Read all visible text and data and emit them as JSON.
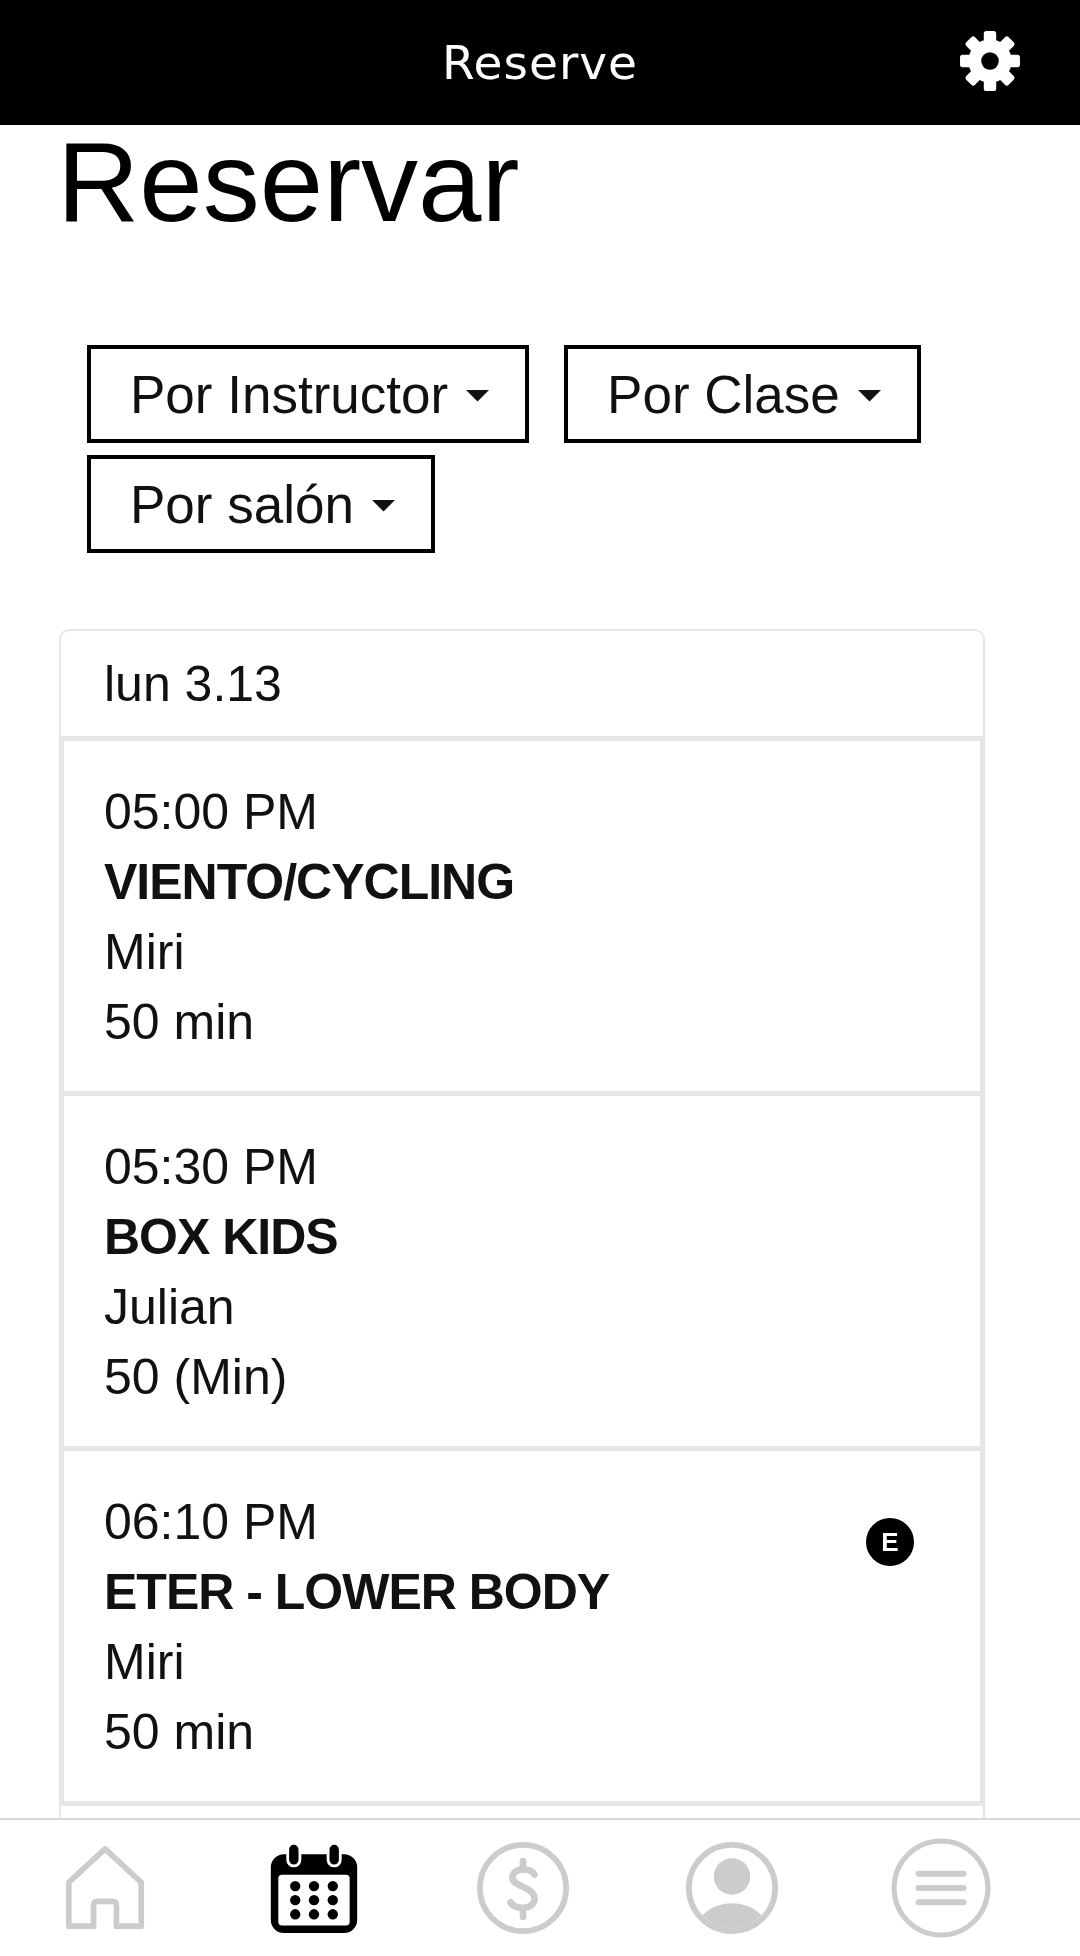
{
  "top_bar": {
    "title": "Reserve"
  },
  "page_title": "Reservar",
  "filters": [
    {
      "label": "Por Instructor"
    },
    {
      "label": "Por Clase"
    },
    {
      "label": "Por salón"
    }
  ],
  "schedule": {
    "date": "lun 3.13",
    "classes": [
      {
        "time": "05:00 PM",
        "name": "VIENTO/CYCLING",
        "instructor": "Miri",
        "duration": "50 min"
      },
      {
        "time": "05:30 PM",
        "name": "BOX KIDS",
        "instructor": "Julian",
        "duration": "50 (Min)"
      },
      {
        "time": "06:10 PM",
        "name": "ETER - LOWER BODY",
        "instructor": "Miri",
        "duration": "50 min",
        "badge": "E"
      }
    ]
  },
  "bottom_nav": {
    "items": [
      {
        "kind": "home",
        "selected": false
      },
      {
        "kind": "calendar",
        "selected": true
      },
      {
        "kind": "payments",
        "selected": false
      },
      {
        "kind": "profile",
        "selected": false
      },
      {
        "kind": "menu",
        "selected": false
      }
    ]
  }
}
